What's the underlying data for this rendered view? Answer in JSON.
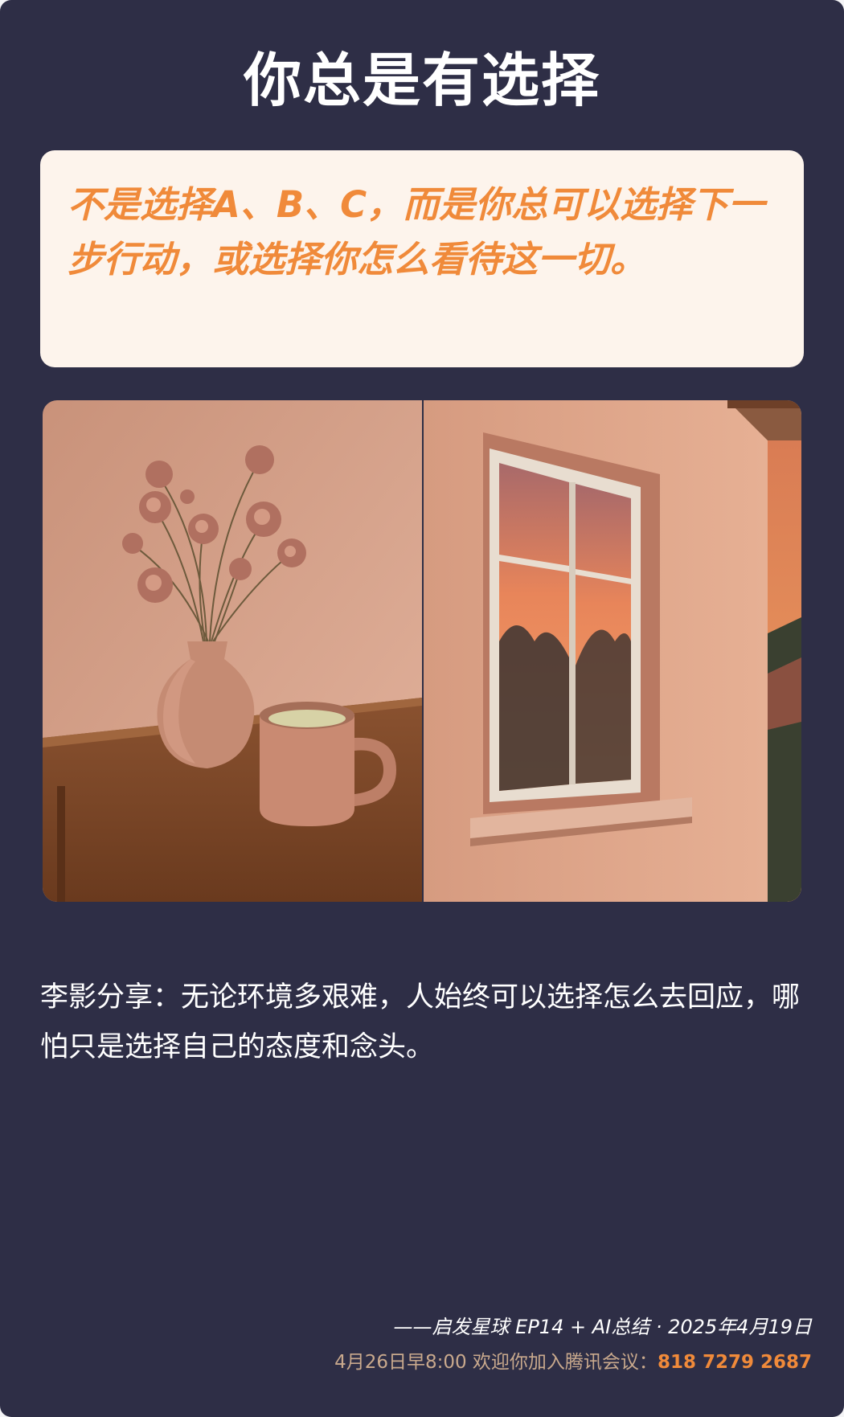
{
  "title": "你总是有选择",
  "quote": "不是选择A、B、C，而是你总可以选择下一步行动，或选择你怎么看待这一切。",
  "caption": "李影分享：无论环境多艰难，人始终可以选择怎么去回应，哪怕只是选择自己的态度和念头。",
  "footer": {
    "source": "——启发星球 EP14 + AI总结 · 2025年4月19日",
    "invite_prefix": "4月26日早8:00 欢迎你加入腾讯会议：",
    "meeting_id": "818 7279 2687"
  },
  "colors": {
    "background": "#2e2e46",
    "accent": "#f08a3a",
    "quote_box": "#fdf4ec",
    "muted": "#c9a98d"
  }
}
